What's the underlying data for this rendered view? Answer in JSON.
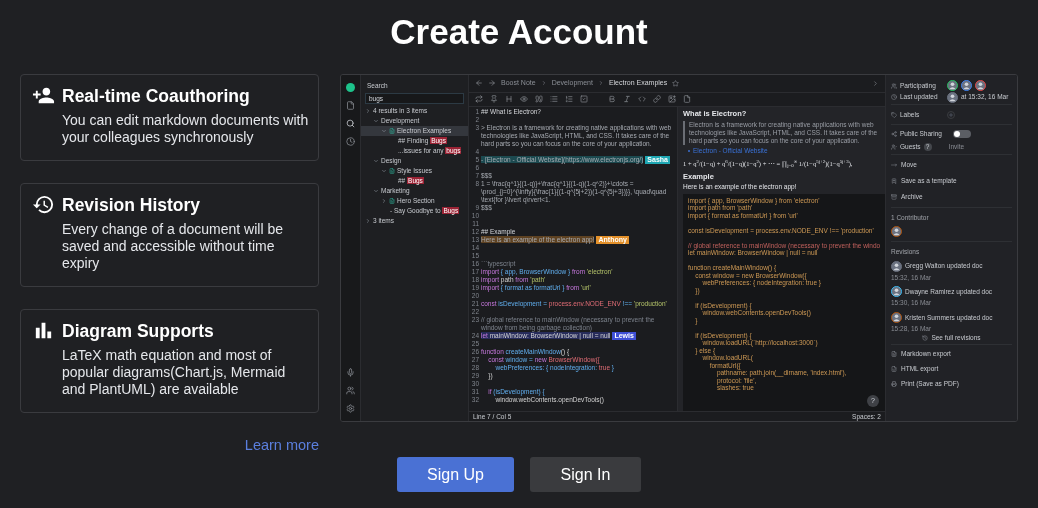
{
  "title": "Create Account",
  "features": [
    {
      "kind": "coauthoring",
      "title": "Real-time Coauthoring",
      "description": "You can edit markdown documents with your colleagues synchronously"
    },
    {
      "kind": "history",
      "title": "Revision History",
      "description": "Every change of a document will be saved and accessible without time expiry"
    },
    {
      "kind": "diagram",
      "title": "Diagram Supports",
      "description": "LaTeX math equation and most of popular diagrams(Chart.js, Mermaid and PlantUML) are available"
    }
  ],
  "learn_more": "Learn more",
  "buttons": [
    {
      "label": "Sign Up",
      "kind": "primary"
    },
    {
      "label": "Sign In",
      "kind": "secondary"
    }
  ],
  "app": {
    "search": {
      "title": "Search",
      "value": "bugs",
      "tree": [
        {
          "kind": "folder",
          "label": "4 results in 3 items",
          "expanded": false,
          "selected": false,
          "children": [
            {
              "kind": "folder",
              "label": "Development",
              "expanded": true,
              "selected": false,
              "children": [
                {
                  "kind": "doc",
                  "label": "Electron Examples",
                  "expanded": true,
                  "selected": true,
                  "children": [
                    {
                      "kind": "match",
                      "before": "## Finding ",
                      "match": "Bugs",
                      "selected": false
                    },
                    {
                      "kind": "match",
                      "before": "...issues for any ",
                      "match": "bugs",
                      "selected": false
                    }
                  ]
                }
              ]
            },
            {
              "kind": "folder",
              "label": "Design",
              "expanded": true,
              "selected": false,
              "children": [
                {
                  "kind": "doc",
                  "label": "Style Issues",
                  "expanded": true,
                  "selected": false,
                  "children": [
                    {
                      "kind": "match",
                      "before": "## ",
                      "match": "Bugs",
                      "selected": false
                    }
                  ]
                }
              ]
            },
            {
              "kind": "folder",
              "label": "Marketing",
              "expanded": true,
              "selected": false,
              "children": [
                {
                  "kind": "doc",
                  "label": "Hero Section",
                  "expanded": false,
                  "selected": false
                },
                {
                  "kind": "match",
                  "before": "- Say Goodbye to ",
                  "match": "Bugs",
                  "selected": false
                }
              ]
            }
          ]
        },
        {
          "kind": "folder",
          "label": "3 items",
          "expanded": false,
          "selected": false
        }
      ]
    },
    "breadcrumb": [
      "Boost Note",
      "Development",
      "Electron Examples"
    ],
    "editor": [
      {
        "num": "1",
        "segments": [
          {
            "text": "## What is Electron?",
            "kind": "heading"
          }
        ]
      },
      {
        "num": "2"
      },
      {
        "num": "3",
        "segments": [
          {
            "text": "> Electron is a framework for creating native applications with web technologies like JavaScript, HTML, and CSS. It takes care of the hard parts so you can focus on the core of your application.",
            "kind": "text"
          }
        ]
      },
      {
        "num": "4"
      },
      {
        "num": "5",
        "highlight": {
          "color": "#1ea7b3",
          "user": "Sasha"
        },
        "segments": [
          {
            "text": "- [Electron - Official Website](https://www.electronjs.org/)",
            "kind": "text"
          }
        ]
      },
      {
        "num": "6"
      },
      {
        "num": "7",
        "segments": [
          {
            "text": "$$$",
            "kind": "text"
          }
        ]
      },
      {
        "num": "8",
        "segments": [
          {
            "text": "1 = \\frac{q^1}{(1-q)}+\\frac{q^1}{(1-q)(1-q^2)}+\\cdots = \\prod_{j=0}^{\\infty}{\\frac{1}{(1-q^{5j+2})(1-q^{5j+3})}}, \\quad\\quad \\text{for }\\lvert q\\rvert<1.",
            "kind": "text"
          }
        ]
      },
      {
        "num": "9",
        "segments": [
          {
            "text": "$$$",
            "kind": "text"
          }
        ]
      },
      {
        "num": "10"
      },
      {
        "num": "11"
      },
      {
        "num": "12",
        "segments": [
          {
            "text": "## Example",
            "kind": "heading"
          }
        ]
      },
      {
        "num": "13",
        "highlight": {
          "color": "#e3902a",
          "user": "Anthony"
        },
        "segments": [
          {
            "text": "Here is an example of the electron app!",
            "kind": "text"
          }
        ]
      },
      {
        "num": "14"
      },
      {
        "num": "15"
      },
      {
        "num": "16",
        "segments": [
          {
            "text": "```typescript",
            "kind": "comment"
          }
        ]
      },
      {
        "num": "17",
        "segments": [
          {
            "text": "import",
            "kind": "keyword"
          },
          {
            "text": " { app, BrowserWindow } ",
            "kind": "ident"
          },
          {
            "text": "from",
            "kind": "keyword"
          },
          {
            "text": " 'electron'",
            "kind": "string"
          }
        ]
      },
      {
        "num": "18",
        "segments": [
          {
            "text": "import",
            "kind": "keyword"
          },
          {
            "text": " path ",
            "kind": "plain"
          },
          {
            "text": "from",
            "kind": "keyword"
          },
          {
            "text": " 'path'",
            "kind": "string"
          }
        ]
      },
      {
        "num": "19",
        "segments": [
          {
            "text": "import",
            "kind": "keyword"
          },
          {
            "text": " { format as formatUrl } ",
            "kind": "ident"
          },
          {
            "text": "from",
            "kind": "keyword"
          },
          {
            "text": " 'url'",
            "kind": "string"
          }
        ]
      },
      {
        "num": "20"
      },
      {
        "num": "21",
        "segments": [
          {
            "text": "const",
            "kind": "keyword"
          },
          {
            "text": " isDevelopment = ",
            "kind": "ident"
          },
          {
            "text": "process.env.NODE_ENV",
            "kind": "var"
          },
          {
            "text": " !== ",
            "kind": "ident"
          },
          {
            "text": "'production'",
            "kind": "string"
          }
        ]
      },
      {
        "num": "22"
      },
      {
        "num": "23",
        "segments": [
          {
            "text": "// global reference to mainWindow (necessary to prevent the window from being garbage collection)",
            "kind": "comment"
          }
        ]
      },
      {
        "num": "24",
        "highlight": {
          "color": "#3f4fd6",
          "user": "Lewis"
        },
        "segments": [
          {
            "text": "let",
            "kind": "keyword"
          },
          {
            "text": " mainWindow: BrowserWindow | null = null",
            "kind": "plain"
          }
        ]
      },
      {
        "num": "25"
      },
      {
        "num": "26",
        "segments": [
          {
            "text": "function",
            "kind": "keyword"
          },
          {
            "text": " createMainWindow",
            "kind": "ident"
          },
          {
            "text": "() {",
            "kind": "plain"
          }
        ]
      },
      {
        "num": "27",
        "segments": [
          {
            "text": "    const",
            "kind": "keyword"
          },
          {
            "text": " window = ",
            "kind": "ident"
          },
          {
            "text": "new",
            "kind": "keyword"
          },
          {
            "text": " BrowserWindow({",
            "kind": "var"
          }
        ]
      },
      {
        "num": "28",
        "segments": [
          {
            "text": "        webPreferences: { nodeIntegration: ",
            "kind": "ident"
          },
          {
            "text": "true",
            "kind": "var"
          },
          {
            "text": " }",
            "kind": "ident"
          }
        ]
      },
      {
        "num": "29",
        "segments": [
          {
            "text": "    })",
            "kind": "plain"
          }
        ]
      },
      {
        "num": "30"
      },
      {
        "num": "31",
        "segments": [
          {
            "text": "    if",
            "kind": "keyword"
          },
          {
            "text": " (isDevelopment) {",
            "kind": "ident"
          }
        ]
      },
      {
        "num": "32",
        "segments": [
          {
            "text": "        window.webContents.openDevTools()",
            "kind": "plain"
          }
        ]
      }
    ],
    "cursor": "Line 7 / Col 5",
    "indent": "Spaces: 2",
    "preview": {
      "heading": "What is Electron?",
      "quote": "Electron is a framework for creating native applications with web technologies like JavaScript, HTML, and CSS. It takes care of the hard parts so you can focus on the core of your application.",
      "link": "Electron - Official Website",
      "formula": "1 + q$^{2}$/(1−q) + q$^{6}$/(1−q)(1−q$^{2}$) + ⋯ = ∏$_{j=0}$$^{∞}$ 1/(1−q$^{5j+2}$)(1−q$^{5j+3}$),",
      "subheading": "Example",
      "paragraph": "Here is an example of the electron app!",
      "code": [
        {
          "kind": "code",
          "text": "import { app, BrowserWindow } from 'electron'"
        },
        {
          "kind": "code",
          "text": "import path from 'path'"
        },
        {
          "kind": "code",
          "text": "import { format as formatUrl } from 'url'"
        },
        {
          "kind": "blank"
        },
        {
          "kind": "code",
          "text": "const isDevelopment = process.env.NODE_ENV !== 'production'"
        },
        {
          "kind": "blank"
        },
        {
          "kind": "comment",
          "text": "// global reference to mainWindow (necessary to prevent the windo"
        },
        {
          "kind": "code",
          "text": "let mainWindow: BrowserWindow | null = null"
        },
        {
          "kind": "blank"
        },
        {
          "kind": "code",
          "text": "function createMainWindow() {"
        },
        {
          "kind": "code",
          "text": "    const window = new BrowserWindow({"
        },
        {
          "kind": "code",
          "text": "        webPreferences: { nodeIntegration: true }"
        },
        {
          "kind": "code",
          "text": "    })"
        },
        {
          "kind": "blank"
        },
        {
          "kind": "code",
          "text": "    if (isDevelopment) {"
        },
        {
          "kind": "code",
          "text": "        window.webContents.openDevTools()"
        },
        {
          "kind": "code",
          "text": "    }"
        },
        {
          "kind": "blank"
        },
        {
          "kind": "code",
          "text": "    if (isDevelopment) {"
        },
        {
          "kind": "code",
          "text": "        window.loadURL(`http://localhost:3000`)"
        },
        {
          "kind": "code",
          "text": "    } else {"
        },
        {
          "kind": "code",
          "text": "        window.loadURL("
        },
        {
          "kind": "code",
          "text": "            formatUrl({"
        },
        {
          "kind": "code",
          "text": "                pathname: path.join(__dirname, 'index.html'),"
        },
        {
          "kind": "code",
          "text": "                protocol: 'file',"
        },
        {
          "kind": "code",
          "text": "                slashes: true"
        }
      ],
      "help": "?"
    },
    "panel": {
      "participating": "Participating",
      "last_updated": "Last updated",
      "updated_at": "at 15:32, 16 Mar",
      "labels": "Labels",
      "public_sharing": {
        "label": "Public Sharing",
        "on": false
      },
      "guests": "Guests",
      "guests_help": "?",
      "invite": "Invite",
      "actions": [
        {
          "kind": "move",
          "label": "Move"
        },
        {
          "kind": "template",
          "label": "Save as a template"
        },
        {
          "kind": "archive",
          "label": "Archive"
        }
      ],
      "contributors": "1 Contributor",
      "revisions_title": "Revisions",
      "revisions": [
        {
          "text": "Gregg Walton updated doc",
          "time": "15:32, 16 Mar"
        },
        {
          "text": "Dwayne Ramirez updated doc",
          "time": "15:30, 16 Mar"
        },
        {
          "text": "Kristen Summers updated doc",
          "time": "15:28, 16 Mar"
        }
      ],
      "see_all": "See full revisions",
      "exports": [
        {
          "kind": "markdown",
          "label": "Markdown export"
        },
        {
          "kind": "html",
          "label": "HTML export"
        },
        {
          "kind": "print",
          "label": "Print (Save as PDF)"
        }
      ]
    }
  }
}
